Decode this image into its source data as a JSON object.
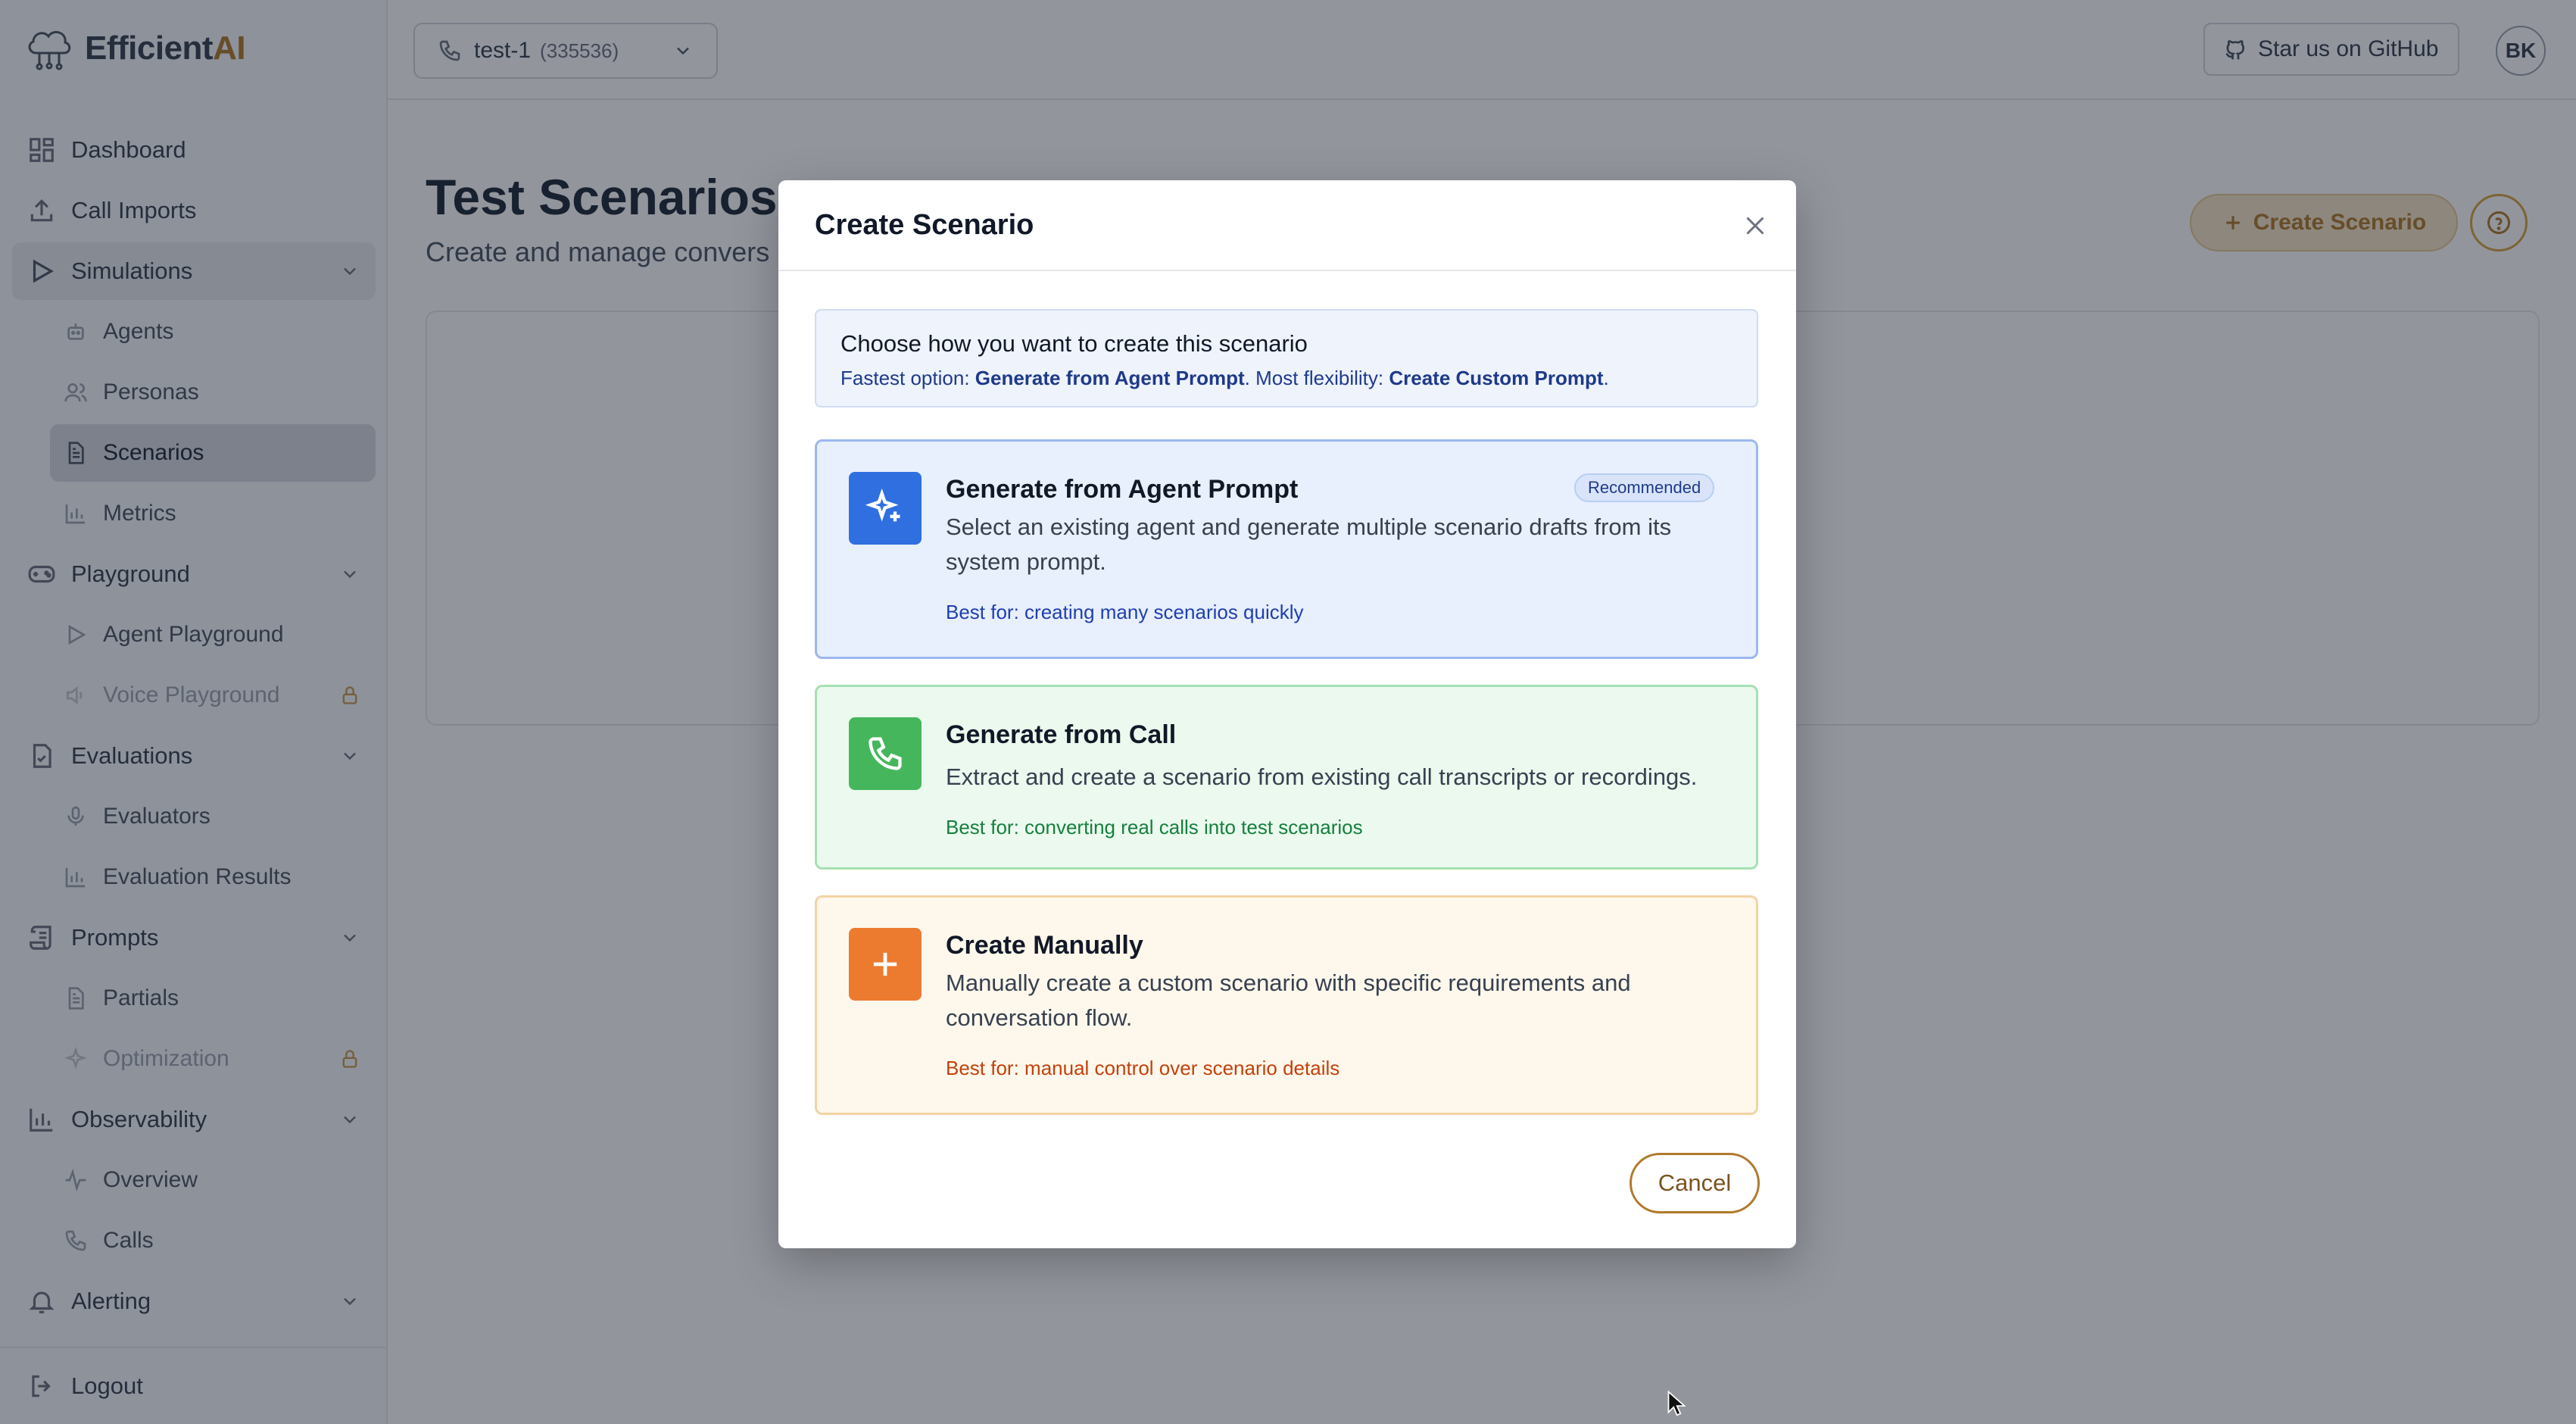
{
  "brand": {
    "name_part1": "Efficient",
    "name_part2": "AI"
  },
  "sidebar": {
    "items": [
      {
        "label": "Dashboard",
        "icon": "dashboard-icon"
      },
      {
        "label": "Call Imports",
        "icon": "upload-icon"
      },
      {
        "label": "Simulations",
        "icon": "play-icon",
        "expanded": true
      },
      {
        "label": "Agents",
        "icon": "bot-icon"
      },
      {
        "label": "Personas",
        "icon": "users-icon"
      },
      {
        "label": "Scenarios",
        "icon": "document-icon",
        "active": true
      },
      {
        "label": "Metrics",
        "icon": "bar-chart-icon"
      },
      {
        "label": "Playground",
        "icon": "gamepad-icon",
        "expanded": true
      },
      {
        "label": "Agent Playground",
        "icon": "play-icon"
      },
      {
        "label": "Voice Playground",
        "icon": "speaker-icon",
        "locked": true
      },
      {
        "label": "Evaluations",
        "icon": "clipboard-check-icon",
        "expanded": true
      },
      {
        "label": "Evaluators",
        "icon": "microphone-icon"
      },
      {
        "label": "Evaluation Results",
        "icon": "bar-chart-icon"
      },
      {
        "label": "Prompts",
        "icon": "scroll-icon",
        "expanded": true
      },
      {
        "label": "Partials",
        "icon": "document-icon"
      },
      {
        "label": "Optimization",
        "icon": "sparkles-icon",
        "locked": true
      },
      {
        "label": "Observability",
        "icon": "bar-chart-icon",
        "expanded": true
      },
      {
        "label": "Overview",
        "icon": "activity-icon"
      },
      {
        "label": "Calls",
        "icon": "phone-icon"
      },
      {
        "label": "Alerting",
        "icon": "bell-icon",
        "expanded": true
      }
    ],
    "logout": "Logout"
  },
  "topbar": {
    "project_name": "test-1",
    "project_id": "(335536)",
    "github_label": "Star us on GitHub",
    "avatar_initials": "BK"
  },
  "main": {
    "title": "Test Scenarios",
    "subtitle": "Create and manage convers",
    "create_button": "Create Scenario"
  },
  "modal": {
    "title": "Create Scenario",
    "info": {
      "title": "Choose how you want to create this scenario",
      "prefix": "Fastest option: ",
      "fastest": "Generate from Agent Prompt",
      "middle": ". Most flexibility: ",
      "flexible": "Create Custom Prompt",
      "suffix": "."
    },
    "options": [
      {
        "title": "Generate from Agent Prompt",
        "badge": "Recommended",
        "description": "Select an existing agent and generate multiple scenario drafts from its system prompt.",
        "best_for": "Best for: creating many scenarios quickly",
        "color": "#2f6fe0",
        "icon": "sparkles-icon"
      },
      {
        "title": "Generate from Call",
        "description": "Extract and create a scenario from existing call transcripts or recordings.",
        "best_for": "Best for: converting real calls into test scenarios",
        "color": "#45b65c",
        "icon": "phone-icon"
      },
      {
        "title": "Create Manually",
        "description": "Manually create a custom scenario with specific requirements and conversation flow.",
        "best_for": "Best for: manual control over scenario details",
        "color": "#ec7a2f",
        "icon": "plus-icon"
      }
    ],
    "cancel": "Cancel"
  }
}
